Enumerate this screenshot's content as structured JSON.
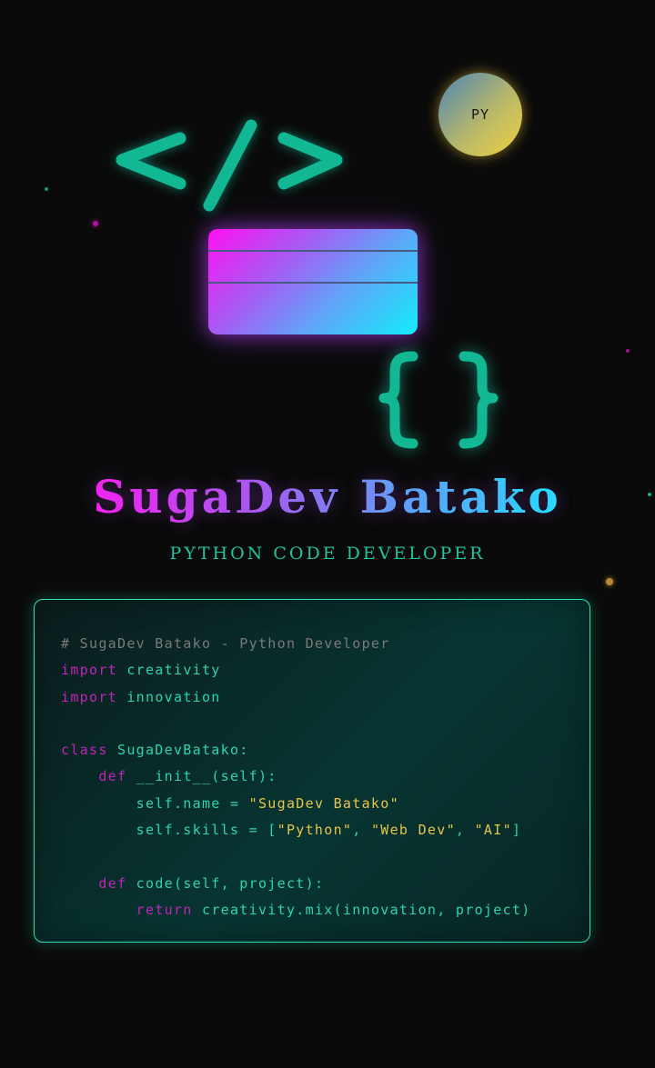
{
  "badge": {
    "label": "PY"
  },
  "hero": {
    "name": "SugaDev Batako",
    "subtitle": "PYTHON CODE DEVELOPER"
  },
  "icons": {
    "code_tag": "code-tag-icon",
    "python_badge": "python-badge-icon",
    "screen": "screen-icon",
    "braces": "braces-icon"
  },
  "colors": {
    "background": "#0a0a0a",
    "accent": "#1fc59e",
    "magenta": "#ff1cf0",
    "cyan": "#16f0ff",
    "gold": "#e6c44a"
  },
  "code": {
    "lines": [
      [
        {
          "t": "# SugaDev Batako - Python Developer",
          "c": "comment"
        }
      ],
      [
        {
          "t": "import",
          "c": "kw"
        },
        {
          "t": " creativity",
          "c": "text"
        }
      ],
      [
        {
          "t": "import",
          "c": "kw"
        },
        {
          "t": " innovation",
          "c": "text"
        }
      ],
      [],
      [
        {
          "t": "class",
          "c": "kw"
        },
        {
          "t": " SugaDevBatako:",
          "c": "text"
        }
      ],
      [
        {
          "t": "    "
        },
        {
          "t": "def",
          "c": "kw"
        },
        {
          "t": " __init__(self):",
          "c": "text"
        }
      ],
      [
        {
          "t": "        self.name = ",
          "c": "text"
        },
        {
          "t": "\"SugaDev Batako\"",
          "c": "str"
        }
      ],
      [
        {
          "t": "        self.skills = [",
          "c": "text"
        },
        {
          "t": "\"Python\"",
          "c": "str"
        },
        {
          "t": ", ",
          "c": "text"
        },
        {
          "t": "\"Web Dev\"",
          "c": "str"
        },
        {
          "t": ", ",
          "c": "text"
        },
        {
          "t": "\"AI\"",
          "c": "str"
        },
        {
          "t": "]",
          "c": "text"
        }
      ],
      [],
      [
        {
          "t": "    "
        },
        {
          "t": "def",
          "c": "kw"
        },
        {
          "t": " code(self, project):",
          "c": "text"
        }
      ],
      [
        {
          "t": "        "
        },
        {
          "t": "return",
          "c": "kw"
        },
        {
          "t": " creativity.mix(innovation, project)",
          "c": "text"
        }
      ]
    ]
  }
}
